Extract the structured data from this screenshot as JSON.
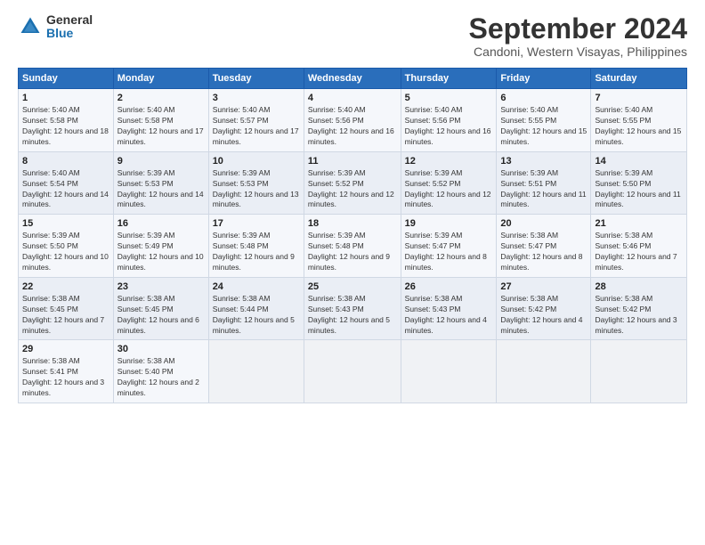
{
  "logo": {
    "general": "General",
    "blue": "Blue"
  },
  "calendar": {
    "title": "September 2024",
    "subtitle": "Candoni, Western Visayas, Philippines",
    "headers": [
      "Sunday",
      "Monday",
      "Tuesday",
      "Wednesday",
      "Thursday",
      "Friday",
      "Saturday"
    ],
    "weeks": [
      [
        null,
        null,
        {
          "day": "3",
          "sunrise": "Sunrise: 5:40 AM",
          "sunset": "Sunset: 5:57 PM",
          "daylight": "Daylight: 12 hours and 17 minutes."
        },
        {
          "day": "4",
          "sunrise": "Sunrise: 5:40 AM",
          "sunset": "Sunset: 5:56 PM",
          "daylight": "Daylight: 12 hours and 16 minutes."
        },
        {
          "day": "5",
          "sunrise": "Sunrise: 5:40 AM",
          "sunset": "Sunset: 5:56 PM",
          "daylight": "Daylight: 12 hours and 16 minutes."
        },
        {
          "day": "6",
          "sunrise": "Sunrise: 5:40 AM",
          "sunset": "Sunset: 5:55 PM",
          "daylight": "Daylight: 12 hours and 15 minutes."
        },
        {
          "day": "7",
          "sunrise": "Sunrise: 5:40 AM",
          "sunset": "Sunset: 5:55 PM",
          "daylight": "Daylight: 12 hours and 15 minutes."
        }
      ],
      [
        {
          "day": "1",
          "sunrise": "Sunrise: 5:40 AM",
          "sunset": "Sunset: 5:58 PM",
          "daylight": "Daylight: 12 hours and 18 minutes."
        },
        {
          "day": "2",
          "sunrise": "Sunrise: 5:40 AM",
          "sunset": "Sunset: 5:58 PM",
          "daylight": "Daylight: 12 hours and 17 minutes."
        },
        {
          "day": "3",
          "sunrise": "Sunrise: 5:40 AM",
          "sunset": "Sunset: 5:57 PM",
          "daylight": "Daylight: 12 hours and 17 minutes."
        },
        {
          "day": "4",
          "sunrise": "Sunrise: 5:40 AM",
          "sunset": "Sunset: 5:56 PM",
          "daylight": "Daylight: 12 hours and 16 minutes."
        },
        {
          "day": "5",
          "sunrise": "Sunrise: 5:40 AM",
          "sunset": "Sunset: 5:56 PM",
          "daylight": "Daylight: 12 hours and 16 minutes."
        },
        {
          "day": "6",
          "sunrise": "Sunrise: 5:40 AM",
          "sunset": "Sunset: 5:55 PM",
          "daylight": "Daylight: 12 hours and 15 minutes."
        },
        {
          "day": "7",
          "sunrise": "Sunrise: 5:40 AM",
          "sunset": "Sunset: 5:55 PM",
          "daylight": "Daylight: 12 hours and 15 minutes."
        }
      ],
      [
        {
          "day": "8",
          "sunrise": "Sunrise: 5:40 AM",
          "sunset": "Sunset: 5:54 PM",
          "daylight": "Daylight: 12 hours and 14 minutes."
        },
        {
          "day": "9",
          "sunrise": "Sunrise: 5:39 AM",
          "sunset": "Sunset: 5:53 PM",
          "daylight": "Daylight: 12 hours and 14 minutes."
        },
        {
          "day": "10",
          "sunrise": "Sunrise: 5:39 AM",
          "sunset": "Sunset: 5:53 PM",
          "daylight": "Daylight: 12 hours and 13 minutes."
        },
        {
          "day": "11",
          "sunrise": "Sunrise: 5:39 AM",
          "sunset": "Sunset: 5:52 PM",
          "daylight": "Daylight: 12 hours and 12 minutes."
        },
        {
          "day": "12",
          "sunrise": "Sunrise: 5:39 AM",
          "sunset": "Sunset: 5:52 PM",
          "daylight": "Daylight: 12 hours and 12 minutes."
        },
        {
          "day": "13",
          "sunrise": "Sunrise: 5:39 AM",
          "sunset": "Sunset: 5:51 PM",
          "daylight": "Daylight: 12 hours and 11 minutes."
        },
        {
          "day": "14",
          "sunrise": "Sunrise: 5:39 AM",
          "sunset": "Sunset: 5:50 PM",
          "daylight": "Daylight: 12 hours and 11 minutes."
        }
      ],
      [
        {
          "day": "15",
          "sunrise": "Sunrise: 5:39 AM",
          "sunset": "Sunset: 5:50 PM",
          "daylight": "Daylight: 12 hours and 10 minutes."
        },
        {
          "day": "16",
          "sunrise": "Sunrise: 5:39 AM",
          "sunset": "Sunset: 5:49 PM",
          "daylight": "Daylight: 12 hours and 10 minutes."
        },
        {
          "day": "17",
          "sunrise": "Sunrise: 5:39 AM",
          "sunset": "Sunset: 5:48 PM",
          "daylight": "Daylight: 12 hours and 9 minutes."
        },
        {
          "day": "18",
          "sunrise": "Sunrise: 5:39 AM",
          "sunset": "Sunset: 5:48 PM",
          "daylight": "Daylight: 12 hours and 9 minutes."
        },
        {
          "day": "19",
          "sunrise": "Sunrise: 5:39 AM",
          "sunset": "Sunset: 5:47 PM",
          "daylight": "Daylight: 12 hours and 8 minutes."
        },
        {
          "day": "20",
          "sunrise": "Sunrise: 5:38 AM",
          "sunset": "Sunset: 5:47 PM",
          "daylight": "Daylight: 12 hours and 8 minutes."
        },
        {
          "day": "21",
          "sunrise": "Sunrise: 5:38 AM",
          "sunset": "Sunset: 5:46 PM",
          "daylight": "Daylight: 12 hours and 7 minutes."
        }
      ],
      [
        {
          "day": "22",
          "sunrise": "Sunrise: 5:38 AM",
          "sunset": "Sunset: 5:45 PM",
          "daylight": "Daylight: 12 hours and 7 minutes."
        },
        {
          "day": "23",
          "sunrise": "Sunrise: 5:38 AM",
          "sunset": "Sunset: 5:45 PM",
          "daylight": "Daylight: 12 hours and 6 minutes."
        },
        {
          "day": "24",
          "sunrise": "Sunrise: 5:38 AM",
          "sunset": "Sunset: 5:44 PM",
          "daylight": "Daylight: 12 hours and 5 minutes."
        },
        {
          "day": "25",
          "sunrise": "Sunrise: 5:38 AM",
          "sunset": "Sunset: 5:43 PM",
          "daylight": "Daylight: 12 hours and 5 minutes."
        },
        {
          "day": "26",
          "sunrise": "Sunrise: 5:38 AM",
          "sunset": "Sunset: 5:43 PM",
          "daylight": "Daylight: 12 hours and 4 minutes."
        },
        {
          "day": "27",
          "sunrise": "Sunrise: 5:38 AM",
          "sunset": "Sunset: 5:42 PM",
          "daylight": "Daylight: 12 hours and 4 minutes."
        },
        {
          "day": "28",
          "sunrise": "Sunrise: 5:38 AM",
          "sunset": "Sunset: 5:42 PM",
          "daylight": "Daylight: 12 hours and 3 minutes."
        }
      ],
      [
        {
          "day": "29",
          "sunrise": "Sunrise: 5:38 AM",
          "sunset": "Sunset: 5:41 PM",
          "daylight": "Daylight: 12 hours and 3 minutes."
        },
        {
          "day": "30",
          "sunrise": "Sunrise: 5:38 AM",
          "sunset": "Sunset: 5:40 PM",
          "daylight": "Daylight: 12 hours and 2 minutes."
        },
        null,
        null,
        null,
        null,
        null
      ]
    ]
  }
}
